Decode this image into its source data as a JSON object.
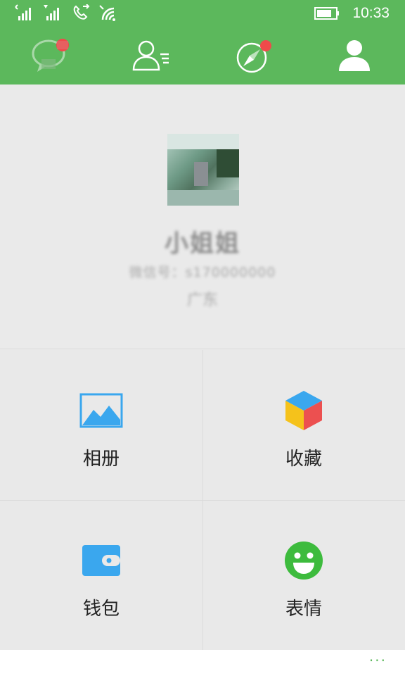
{
  "status_bar": {
    "time": "10:33",
    "icons": [
      "signal-icon",
      "signal-icon",
      "call-forward-icon",
      "wifi-icon",
      "battery-icon"
    ]
  },
  "tabs": [
    {
      "icon": "chat-bubble-icon",
      "badge": true
    },
    {
      "icon": "contacts-icon",
      "badge": false
    },
    {
      "icon": "compass-icon",
      "badge": true
    },
    {
      "icon": "person-icon",
      "badge": false,
      "active": true
    }
  ],
  "profile": {
    "nickname": "小姐姐",
    "account_id": "微信号：s170000000",
    "region": "广东"
  },
  "grid": [
    {
      "label": "相册",
      "icon": "album-icon"
    },
    {
      "label": "收藏",
      "icon": "favorites-cube-icon"
    },
    {
      "label": "钱包",
      "icon": "wallet-icon"
    },
    {
      "label": "表情",
      "icon": "smiley-icon"
    }
  ],
  "app_bar": {
    "more_label": "···"
  },
  "colors": {
    "brand_green": "#5cb85c",
    "badge_red": "#f04a4a",
    "album_blue": "#3aa7ee",
    "smiley_green": "#3dbb3d"
  }
}
